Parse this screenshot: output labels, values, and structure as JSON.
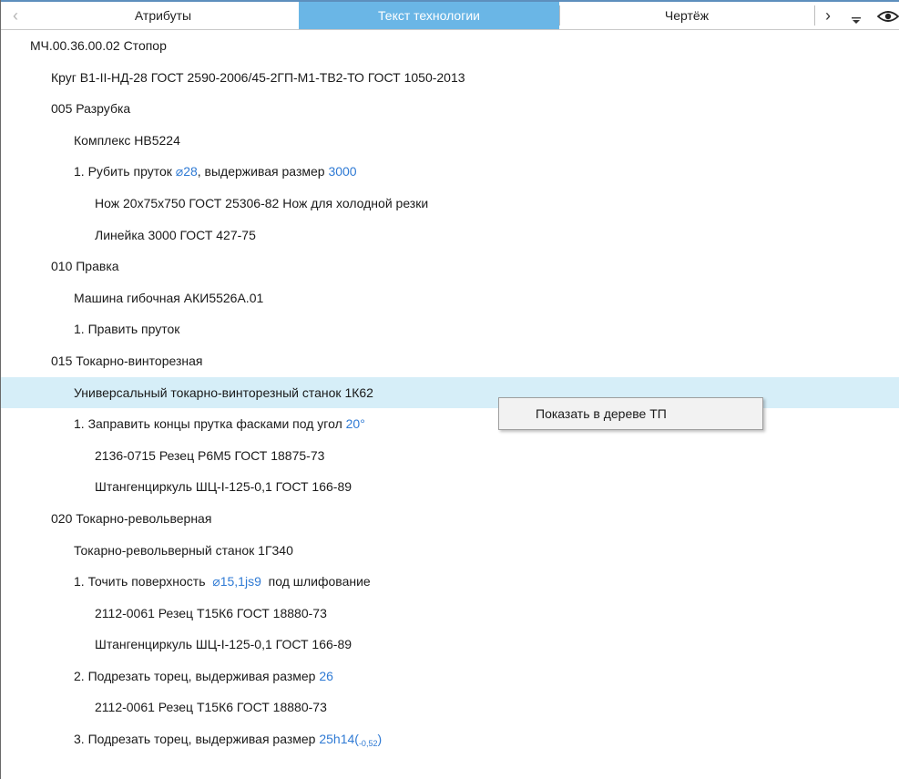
{
  "tabs": {
    "attributes": "Атрибуты",
    "tech_text": "Текст технологии",
    "drawing": "Чертёж"
  },
  "icons": {
    "prev": "chevron-left-icon",
    "next": "chevron-right-icon",
    "menu": "overflow-menu-icon",
    "view": "eye-icon"
  },
  "colors": {
    "active_tab": "#6ab6e6",
    "highlight_row": "#d6eef8",
    "value_blue": "#2f7ad4"
  },
  "tree": {
    "r0": "МЧ.00.36.00.02 Стопор",
    "r1": "Круг В1-II-НД-28 ГОСТ 2590-2006/45-2ГП-М1-ТВ2-ТО ГОСТ 1050-2013",
    "r2": "005 Разрубка",
    "r3": "Комплекс НВ5224",
    "r4_pre": "1. Рубить пруток ",
    "r4_v1": "⌀28",
    "r4_mid": ", выдерживая размер ",
    "r4_v2": "3000",
    "r5": "Нож 20х75х750 ГОСТ 25306-82 Нож для холодной резки",
    "r6": "Линейка 3000 ГОСТ 427-75",
    "r7": "010 Правка",
    "r8": "Машина гибочная АКИ5526А.01",
    "r9": "1. Править пруток",
    "r10": "015 Токарно-винторезная",
    "r11": "Универсальный токарно-винторезный станок 1К62",
    "r12_pre": "1. Заправить концы прутка фасками под угол ",
    "r12_v": "20°",
    "r13": "2136-0715 Резец Р6М5 ГОСТ 18875-73",
    "r14": "Штангенциркуль ШЦ-I-125-0,1 ГОСТ 166-89",
    "r15": "020 Токарно-револьверная",
    "r16": "Токарно-револьверный станок 1Г340",
    "r17_pre": "1. Точить поверхность  ",
    "r17_v": "⌀15,1js9",
    "r17_post": "  под шлифование",
    "r18": "2112-0061 Резец Т15К6 ГОСТ 18880-73",
    "r19": "Штангенциркуль ШЦ-I-125-0,1 ГОСТ 166-89",
    "r20_pre": "2. Подрезать торец, выдерживая размер ",
    "r20_v": "26",
    "r21": "2112-0061 Резец Т15К6 ГОСТ 18880-73",
    "r22_pre": "3. Подрезать торец, выдерживая размер ",
    "r22_v": "25h14(",
    "r22_sub": "-0,52",
    "r22_close": ")"
  },
  "context_menu": {
    "show_in_tree": "Показать в дереве ТП"
  }
}
